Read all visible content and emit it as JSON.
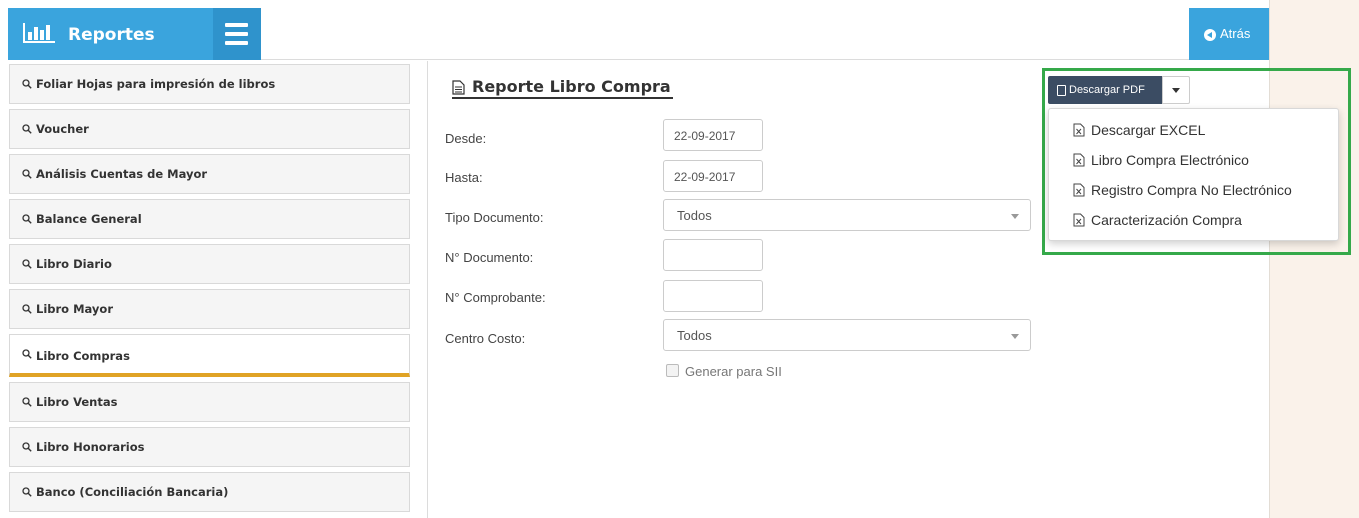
{
  "header": {
    "brand_title": "Reportes",
    "back_label": "Atrás"
  },
  "sidebar": {
    "items": [
      {
        "label": "Foliar Hojas para impresión de libros"
      },
      {
        "label": "Voucher"
      },
      {
        "label": "Análisis Cuentas de Mayor"
      },
      {
        "label": "Balance General"
      },
      {
        "label": "Libro Diario"
      },
      {
        "label": "Libro Mayor"
      },
      {
        "label": "Libro Compras"
      },
      {
        "label": "Libro Ventas"
      },
      {
        "label": "Libro Honorarios"
      },
      {
        "label": "Banco (Conciliación Bancaria)"
      }
    ],
    "active_item": "Libro Compras"
  },
  "content": {
    "title": "Reporte Libro Compra",
    "form": {
      "desde_label": "Desde:",
      "desde_value": "22-09-2017",
      "hasta_label": "Hasta:",
      "hasta_value": "22-09-2017",
      "tipo_documento_label": "Tipo Documento:",
      "tipo_documento_value": "Todos",
      "n_documento_label": "N° Documento:",
      "n_documento_value": "",
      "n_comprobante_label": "N° Comprobante:",
      "n_comprobante_value": "",
      "centro_costo_label": "Centro Costo:",
      "centro_costo_value": "Todos",
      "generar_sii_label": "Generar para SII"
    }
  },
  "actions": {
    "pdf_label": "Descargar PDF",
    "dropdown": [
      {
        "label": "Descargar EXCEL"
      },
      {
        "label": "Libro Compra Electrónico"
      },
      {
        "label": "Registro Compra No Electrónico"
      },
      {
        "label": "Caracterización Compra"
      }
    ]
  },
  "colors": {
    "header_blue": "#3aa4dd",
    "active_underline": "#e0a325",
    "highlight_green": "#35a94a",
    "pdf_button": "#3b4c63"
  }
}
